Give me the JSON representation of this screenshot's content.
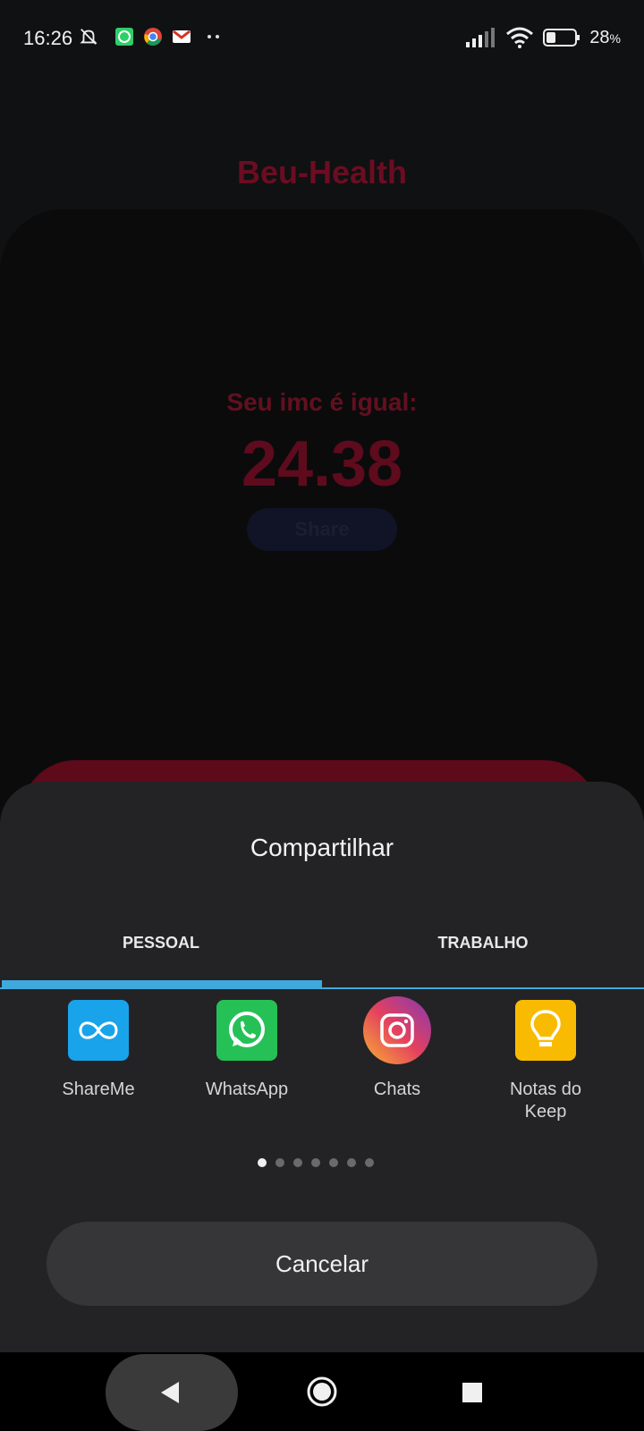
{
  "status_bar": {
    "time": "16:26",
    "battery_percent": "28",
    "battery_unit": "%",
    "notification_icons": [
      "mute-icon",
      "whatsapp-icon",
      "chrome-icon",
      "gmail-icon",
      "more-dots-icon"
    ],
    "right_icons": [
      "signal-icon",
      "wifi-icon",
      "battery-icon"
    ]
  },
  "app": {
    "title": "Beu-Health",
    "imc_label": "Seu imc é igual:",
    "imc_value": "24.38",
    "share_label": "Share",
    "accent_color": "#6b0d22"
  },
  "share_sheet": {
    "title": "Compartilhar",
    "tabs": [
      {
        "label": "PESSOAL",
        "selected": true
      },
      {
        "label": "TRABALHO",
        "selected": false
      }
    ],
    "apps": [
      {
        "name": "ShareMe",
        "icon": "shareme-icon"
      },
      {
        "name": "WhatsApp",
        "icon": "whatsapp-icon"
      },
      {
        "name": "Chats",
        "icon": "instagram-icon"
      },
      {
        "name": "Notas do\nKeep",
        "icon": "keep-icon"
      }
    ],
    "page_count": 7,
    "current_page": 1,
    "cancel_label": "Cancelar",
    "tab_color": "#3fa9dd"
  },
  "nav_bar": {
    "buttons": [
      "back-icon",
      "home-icon",
      "recents-icon"
    ]
  }
}
